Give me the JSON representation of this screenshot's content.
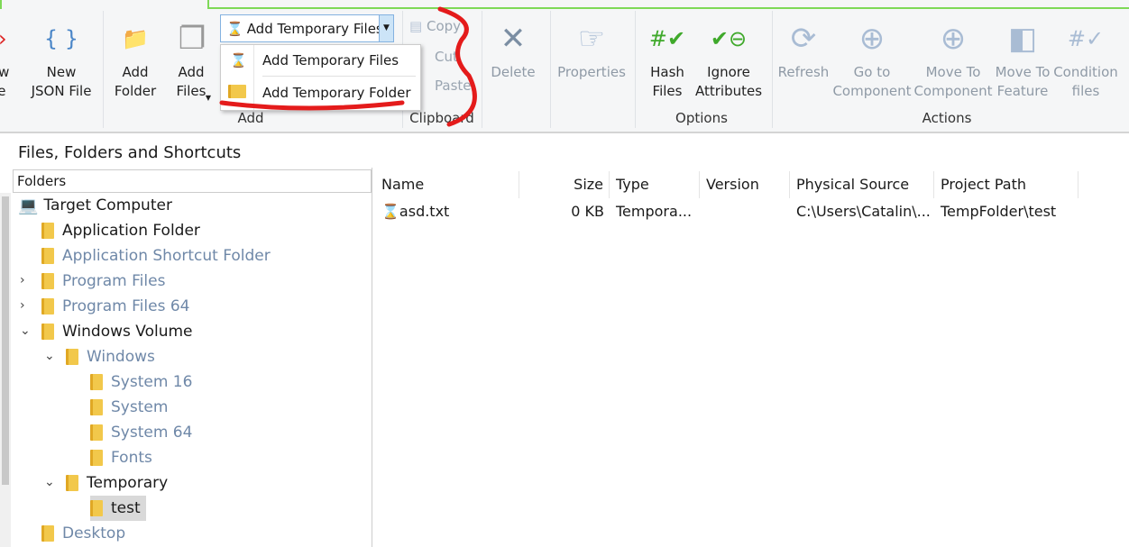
{
  "ribbon": {
    "buttons": [
      {
        "label": "New\nFile",
        "icon": "html-file-icon"
      },
      {
        "label": "New\nJSON File",
        "icon": "json-file-icon"
      },
      {
        "label": "Add\nFolder",
        "icon": "add-folder-icon"
      },
      {
        "label": "Add\nFiles",
        "icon": "add-files-icon"
      },
      {
        "label": "Delete",
        "icon": "delete-x-icon"
      },
      {
        "label": "Properties",
        "icon": "properties-icon"
      },
      {
        "label": "Hash\nFiles",
        "icon": "hash-check-icon"
      },
      {
        "label": "Ignore\nAttributes",
        "icon": "ignore-attributes-icon"
      },
      {
        "label": "Refresh",
        "icon": "refresh-icon"
      },
      {
        "label": "Go to\nComponent",
        "icon": "go-to-component-icon"
      },
      {
        "label": "Move To\nComponent",
        "icon": "move-to-component-icon"
      },
      {
        "label": "Move To\nFeature",
        "icon": "move-to-feature-icon"
      },
      {
        "label": "Condition\nfiles",
        "icon": "condition-files-icon"
      }
    ],
    "clipboard": [
      "Copy",
      "Cut",
      "Paste"
    ],
    "groups": {
      "add": "Add",
      "clipboard": "Clipboard",
      "options": "Options",
      "actions": "Actions"
    },
    "dropdown": {
      "selected": "Add Temporary Files",
      "items": [
        "Add Temporary Files",
        "Add Temporary Folder"
      ]
    }
  },
  "section_title": "Files, Folders and Shortcuts",
  "tree": {
    "header": "Folders",
    "items": [
      {
        "label": "Target Computer",
        "level": 0,
        "state": "none",
        "dim": false
      },
      {
        "label": "Application Folder",
        "level": 1,
        "state": "none",
        "dim": false
      },
      {
        "label": "Application Shortcut Folder",
        "level": 1,
        "state": "none",
        "dim": true
      },
      {
        "label": "Program Files",
        "level": 1,
        "state": "collapsed",
        "dim": true
      },
      {
        "label": "Program Files 64",
        "level": 1,
        "state": "collapsed",
        "dim": true
      },
      {
        "label": "Windows Volume",
        "level": 1,
        "state": "expanded",
        "dim": false
      },
      {
        "label": "Windows",
        "level": 2,
        "state": "expanded",
        "dim": true
      },
      {
        "label": "System 16",
        "level": 3,
        "state": "none",
        "dim": true
      },
      {
        "label": "System",
        "level": 3,
        "state": "none",
        "dim": true
      },
      {
        "label": "System 64",
        "level": 3,
        "state": "none",
        "dim": true
      },
      {
        "label": "Fonts",
        "level": 3,
        "state": "none",
        "dim": true
      },
      {
        "label": "Temporary",
        "level": 2,
        "state": "expanded",
        "dim": false
      },
      {
        "label": "test",
        "level": 3,
        "state": "selected",
        "dim": false
      },
      {
        "label": "Desktop",
        "level": 1,
        "state": "none",
        "dim": true
      }
    ]
  },
  "list": {
    "columns": [
      "Name",
      "Size",
      "Type",
      "Version",
      "Physical Source",
      "Project Path"
    ],
    "rows": [
      [
        "asd.txt",
        "0 KB",
        "Tempora...",
        "",
        "C:\\Users\\Catalin\\...",
        "TempFolder\\test"
      ]
    ]
  }
}
